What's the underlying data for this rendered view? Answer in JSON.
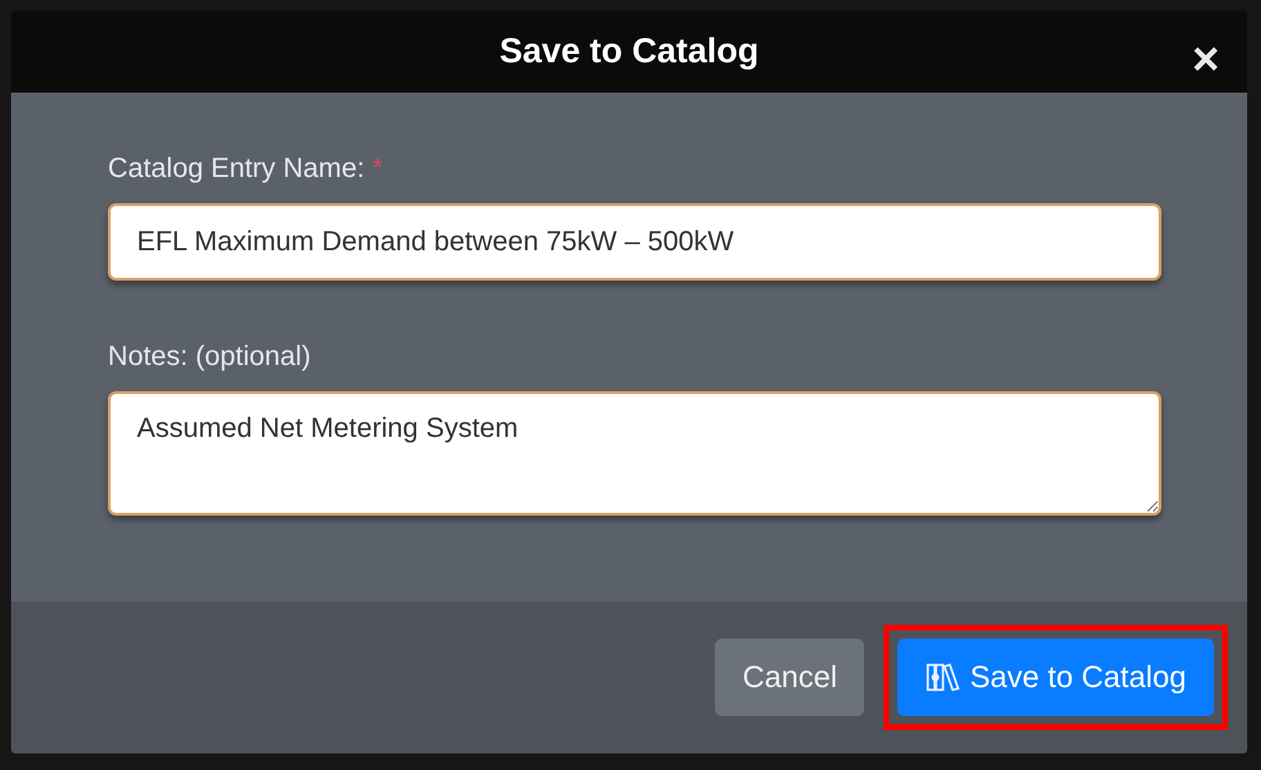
{
  "dialog": {
    "title": "Save to Catalog",
    "close": "×"
  },
  "fields": [
    {
      "kind": "input",
      "label": "Catalog Entry Name:",
      "required": true,
      "value": "EFL Maximum Demand between 75kW – 500kW"
    },
    {
      "kind": "textarea",
      "label": "Notes: (optional)",
      "required": false,
      "value": "Assumed Net Metering System"
    }
  ],
  "required_mark": "*",
  "buttons": [
    {
      "kind": "secondary",
      "label": "Cancel",
      "highlighted": false
    },
    {
      "kind": "primary",
      "label": "Save to Catalog",
      "highlighted": true
    }
  ]
}
